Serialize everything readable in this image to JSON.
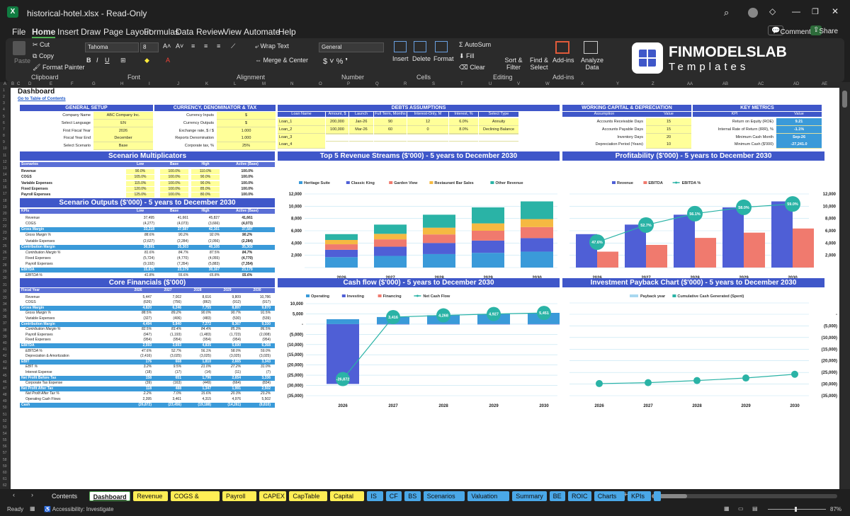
{
  "window": {
    "title": "historical-hotel.xlsx  -  Read-Only"
  },
  "menu": [
    "File",
    "Home",
    "Insert",
    "Draw",
    "Page Layout",
    "Formulas",
    "Data",
    "Review",
    "View",
    "Automate",
    "Help"
  ],
  "topright": {
    "comments": "Comments",
    "share": "Share"
  },
  "ribbon": {
    "paste": "Paste",
    "cut": "Cut",
    "copy": "Copy",
    "format_painter": "Format Painter",
    "clipboard": "Clipboard",
    "font_name": "Tahoma",
    "font_size": "8",
    "font": "Font",
    "wrap": "Wrap Text",
    "merge": "Merge & Center",
    "alignment": "Alignment",
    "numfmt": "General",
    "number": "Number",
    "insert": "Insert",
    "delete": "Delete",
    "format": "Format",
    "cells": "Cells",
    "autosum": "AutoSum",
    "fill": "Fill",
    "clear": "Clear",
    "sort": "Sort & Filter",
    "find": "Find & Select",
    "editing": "Editing",
    "addins": "Add-ins",
    "addins_grp": "Add-ins",
    "analyze": "Analyze Data",
    "brand1": "FINMODELSLAB",
    "brand2": "Templates"
  },
  "columns": [
    "A",
    "B",
    "C",
    "D",
    "E",
    "F",
    "G",
    "H",
    "I",
    "J",
    "K",
    "L",
    "M",
    "N",
    "O",
    "P",
    "Q",
    "R",
    "S",
    "T",
    "U",
    "V",
    "W",
    "X",
    "Y",
    "Z",
    "AA",
    "AB",
    "AC",
    "AD",
    "AE"
  ],
  "sheet": {
    "title": "Dashboard",
    "toc": "Go to Table of Contents",
    "general": {
      "header": "GENERAL SETUP",
      "rows": [
        [
          "Company Name",
          "ABC Company Inc."
        ],
        [
          "Select Language",
          "EN"
        ],
        [
          "First Fiscal Year",
          "2026"
        ],
        [
          "Fiscal Year End",
          "December"
        ],
        [
          "Select Scenario",
          "Base"
        ]
      ]
    },
    "currency": {
      "header": "CURRENCY, DENOMINATOR & TAX",
      "rows": [
        [
          "Currency Inputs",
          "$"
        ],
        [
          "Currency Outputs",
          "$"
        ],
        [
          "Exchange rate, $ / $",
          "1.000"
        ],
        [
          "Reports Denomination",
          "1.000"
        ],
        [
          "Corporate tax, %",
          "25%"
        ]
      ]
    },
    "debts": {
      "header": "DEBTS ASSUMPTIONS",
      "cols": [
        "Loan Name",
        "Amount, $",
        "Launch",
        "Full Term, Months",
        "Interest-Only, M",
        "Interest, %",
        "Select Type"
      ],
      "rows": [
        [
          "Loan_1",
          "200,000",
          "Jan-26",
          "90",
          "12",
          "6.0%",
          "Annuity"
        ],
        [
          "Loan_2",
          "100,000",
          "Mar-26",
          "60",
          "0",
          "8.0%",
          "Declining Balance"
        ],
        [
          "Loan_3",
          "",
          "",
          "",
          "",
          "",
          ""
        ],
        [
          "Loan_4",
          "",
          "",
          "",
          "",
          "",
          ""
        ]
      ]
    },
    "wc": {
      "header": "WORKING CAPITAL & DEPRECIATION",
      "cols": [
        "Assumption",
        "Value"
      ],
      "rows": [
        [
          "Accounts Receivable Days",
          "15"
        ],
        [
          "Accounts Payable Days",
          "15"
        ],
        [
          "Inventory Days",
          "20"
        ],
        [
          "Depreciation Period (Years)",
          "10"
        ]
      ]
    },
    "km": {
      "header": "KEY METRICS",
      "cols": [
        "KPI",
        "Value"
      ],
      "rows": [
        [
          "Return on Equity (ROE)",
          "9.21"
        ],
        [
          "Internal Rate of Return (IRR), %",
          "-1.1%"
        ],
        [
          "Minimum Cash Month",
          "Sep-26"
        ],
        [
          "Minimum Cash ($'000)",
          "-27,241.0"
        ]
      ]
    },
    "scen": {
      "header": "Scenario Multiplicators",
      "cols": [
        "Scenarios",
        "Low",
        "Base",
        "High",
        "Active (Base)"
      ],
      "rows": [
        [
          "Revenue",
          "90.0%",
          "100.0%",
          "110.0%",
          "100.0%"
        ],
        [
          "COGS",
          "105.0%",
          "100.0%",
          "90.0%",
          "100.0%"
        ],
        [
          "Variable Expenses",
          "115.0%",
          "100.0%",
          "90.0%",
          "100.0%"
        ],
        [
          "Fixed Expenses",
          "120.0%",
          "100.0%",
          "85.0%",
          "100.0%"
        ],
        [
          "Payroll Expenses",
          "125.0%",
          "100.0%",
          "80.0%",
          "100.0%"
        ]
      ]
    },
    "so": {
      "header": "Scenario Outputs ($'000) - 5 years to December 2030",
      "cols": [
        "KPIs",
        "Low",
        "Base",
        "High",
        "Active (Base)"
      ],
      "rows": [
        [
          "Revenue",
          "37,495",
          "41,661",
          "45,827",
          "41,661",
          ""
        ],
        [
          "COGS",
          "(4,277)",
          "(4,073)",
          "(3,666)",
          "(4,073)",
          ""
        ],
        [
          "Gross Margin",
          "33,218",
          "37,587",
          "42,161",
          "37,587",
          "hl"
        ],
        [
          "Gross Margin %",
          "88.6%",
          "90.2%",
          "92.0%",
          "90.2%",
          "it"
        ],
        [
          "Variable Expenses",
          "(2,627)",
          "(2,284)",
          "(2,056)",
          "(2,284)",
          ""
        ],
        [
          "Contribution Margin",
          "30,591",
          "35,303",
          "40,105",
          "35,303",
          "hl"
        ],
        [
          "Contribution Margin %",
          "81.6%",
          "84.7%",
          "87.5%",
          "84.7%",
          "it"
        ],
        [
          "Fixed Expenses",
          "(5,724)",
          "(4,770)",
          "(4,055)",
          "(4,770)",
          ""
        ],
        [
          "Payroll Expenses",
          "(9,192)",
          "(7,354)",
          "(5,883)",
          "(7,354)",
          ""
        ],
        [
          "EBITDA",
          "15,675",
          "23,179",
          "30,167",
          "23,179",
          "hl"
        ],
        [
          "EBITDA %",
          "41.8%",
          "55.6%",
          "65.8%",
          "55.6%",
          "it"
        ]
      ]
    },
    "cf": {
      "header": "Core Financials ($'000)",
      "cols": [
        "Fiscal Year",
        "2026",
        "2027",
        "2028",
        "2029",
        "2030"
      ],
      "rows": [
        [
          "Revenue",
          "5,447",
          "7,002",
          "8,616",
          "9,809",
          "10,786",
          ""
        ],
        [
          "COGS",
          "(626)",
          "(756)",
          "(862)",
          "(912)",
          "(917)",
          ""
        ],
        [
          "Gross Margin",
          "4,820",
          "6,246",
          "7,755",
          "8,897",
          "9,870",
          "hl"
        ],
        [
          "Gross Margin %",
          "88.5%",
          "89.2%",
          "90.0%",
          "90.7%",
          "91.5%",
          "it"
        ],
        [
          "Variable Expenses",
          "(327)",
          "(406)",
          "(483)",
          "(530)",
          "(539)",
          ""
        ],
        [
          "Contribution Margin",
          "4,494",
          "5,840",
          "7,272",
          "8,367",
          "9,330",
          "hl"
        ],
        [
          "Contribution Margin %",
          "82.5%",
          "83.4%",
          "84.4%",
          "85.3%",
          "86.5%",
          "it"
        ],
        [
          "Payroll Expenses",
          "(947)",
          "(1,193)",
          "(1,483)",
          "(1,723)",
          "(2,008)",
          ""
        ],
        [
          "Fixed Expenses",
          "(954)",
          "(954)",
          "(954)",
          "(954)",
          "(954)",
          ""
        ],
        [
          "EBITDA",
          "2,593",
          "3,693",
          "4,835",
          "5,690",
          "6,368",
          "hl"
        ],
        [
          "EBITDA %",
          "47.6%",
          "52.7%",
          "56.1%",
          "58.0%",
          "59.0%",
          "it"
        ],
        [
          "Depreciation & Amortization",
          "(2,416)",
          "(3,025)",
          "(3,025)",
          "(3,025)",
          "(3,025)",
          ""
        ],
        [
          "EBIT",
          "176",
          "668",
          "1,810",
          "2,665",
          "3,343",
          "hl"
        ],
        [
          "EBIT %",
          "3.2%",
          "9.5%",
          "21.0%",
          "27.2%",
          "31.0%",
          "it"
        ],
        [
          "Interest Expense",
          "(18)",
          "(17)",
          "(14)",
          "(11)",
          "(7)",
          ""
        ],
        [
          "Net Profit Before Tax",
          "158",
          "651",
          "1,796",
          "2,654",
          "3,336",
          "hl"
        ],
        [
          "Corporate Tax Expense",
          "(39)",
          "(163)",
          "(449)",
          "(664)",
          "(834)",
          ""
        ],
        [
          "Net Profit After Tax",
          "118",
          "488",
          "1,347",
          "1,991",
          "2,502",
          "hl"
        ],
        [
          "Net Profit After Tax %",
          "2.2%",
          "7.0%",
          "15.6%",
          "20.3%",
          "23.2%",
          "it"
        ],
        [
          "Operating Cash Flows",
          "2,395",
          "3,461",
          "4,315",
          "4,976",
          "5,502",
          ""
        ],
        [
          "Cash",
          "(26,872)",
          "(23,456)",
          "(19,188)",
          "(14,261)",
          "(8,810)",
          "hl"
        ]
      ]
    }
  },
  "chart_data": [
    {
      "type": "bar",
      "title": "Top 5 Revenue Streams ($'000) - 5 years to December 2030",
      "stacked": true,
      "categories": [
        "2026",
        "2027",
        "2028",
        "2029",
        "2030"
      ],
      "ylim": [
        0,
        12000
      ],
      "yticks": [
        "12,000",
        "10,000",
        "8,000",
        "6,000",
        "4,000",
        "2,000"
      ],
      "series": [
        {
          "name": "Heritage Suite",
          "color": "#3a9ad9",
          "values": [
            1700,
            1900,
            2200,
            2400,
            2600
          ]
        },
        {
          "name": "Classic King",
          "color": "#4f5fd6",
          "values": [
            1200,
            1500,
            1800,
            2000,
            2200
          ]
        },
        {
          "name": "Garden View",
          "color": "#f07a6e",
          "values": [
            900,
            1200,
            1400,
            1600,
            1800
          ]
        },
        {
          "name": "Restaurant Bar Sales",
          "color": "#f5b942",
          "values": [
            700,
            900,
            1100,
            1200,
            1300
          ]
        },
        {
          "name": "Other Revenue",
          "color": "#2ab3a6",
          "values": [
            947,
            1502,
            2116,
            2609,
            2886
          ]
        }
      ]
    },
    {
      "type": "bar",
      "title": "Profitability ($'000) - 5 years to December 2030",
      "categories": [
        "2026",
        "2027",
        "2028",
        "2029",
        "2030"
      ],
      "ylim": [
        0,
        12000
      ],
      "yticks": [
        "12,000",
        "10,000",
        "8,000",
        "6,000",
        "4,000",
        "2,000"
      ],
      "series": [
        {
          "name": "Revenue",
          "color": "#4f5fd6",
          "values": [
            5447,
            7002,
            8616,
            9809,
            10786
          ]
        },
        {
          "name": "EBITDA",
          "color": "#f07a6e",
          "values": [
            2593,
            3693,
            4835,
            5690,
            6368
          ]
        },
        {
          "name": "EBITDA %",
          "color": "#2ab3a6",
          "type": "line",
          "values": [
            47.6,
            52.7,
            56.1,
            58.0,
            59.0
          ],
          "labels": [
            "47.6%",
            "52.7%",
            "56.1%",
            "58.0%",
            "59.0%"
          ]
        }
      ]
    },
    {
      "type": "bar",
      "title": "Cash flow ($'000) - 5 years to December 2030",
      "categories": [
        "2026",
        "2027",
        "2028",
        "2029",
        "2030"
      ],
      "ylim": [
        -35000,
        10000
      ],
      "yticks": [
        "10,000",
        "5,000",
        "-",
        "(5,000)",
        "(10,000)",
        "(15,000)",
        "(20,000)",
        "(25,000)",
        "(30,000)",
        "(35,000)"
      ],
      "series": [
        {
          "name": "Operating",
          "color": "#3a9ad9",
          "values": [
            2395,
            3461,
            4315,
            4976,
            5502
          ]
        },
        {
          "name": "Investing",
          "color": "#4f5fd6",
          "values": [
            -29267,
            -45,
            -47,
            -49,
            -51
          ]
        },
        {
          "name": "Financing",
          "color": "#f07a6e",
          "values": [
            0,
            0,
            0,
            0,
            0
          ]
        },
        {
          "name": "Net Cash Flow",
          "color": "#2ab3a6",
          "type": "line",
          "values": [
            -26872,
            3416,
            4268,
            4927,
            5451
          ],
          "labels": [
            "-26,872",
            "3,416",
            "4,268",
            "4,927",
            "5,451"
          ]
        }
      ]
    },
    {
      "type": "line",
      "title": "Investment Payback Chart ($'000) - 5 years to December 2030",
      "categories": [
        "2026",
        "2027",
        "2028",
        "2029",
        "2030"
      ],
      "ylim": [
        -35000,
        0
      ],
      "yticks": [
        "-",
        "(5,000)",
        "(10,000)",
        "(15,000)",
        "(20,000)",
        "(25,000)",
        "(30,000)",
        "(35,000)"
      ],
      "series": [
        {
          "name": "Payback year",
          "color": "#a8d8f0",
          "values": []
        },
        {
          "name": "Cumulative Cash Generated (Spent)",
          "color": "#2ab3a6",
          "values": [
            -29800,
            -29400,
            -28500,
            -27400,
            -25800
          ]
        }
      ]
    }
  ],
  "tabs": [
    {
      "label": "Contents",
      "bg": "#1f1f1f",
      "fg": "#e8e8e8"
    },
    {
      "label": "Dashboard",
      "bg": "#ffffff",
      "fg": "#111",
      "active": true
    },
    {
      "label": "Revenue",
      "bg": "#ffee55"
    },
    {
      "label": "COGS & OPEX",
      "bg": "#ffee55"
    },
    {
      "label": "Payroll",
      "bg": "#ffee55"
    },
    {
      "label": "CAPEX",
      "bg": "#ffee55"
    },
    {
      "label": "CapTable",
      "bg": "#ffee55"
    },
    {
      "label": "Capital",
      "bg": "#ffee55"
    },
    {
      "label": "IS",
      "bg": "#4aa8e8"
    },
    {
      "label": "CF",
      "bg": "#4aa8e8"
    },
    {
      "label": "BS",
      "bg": "#4aa8e8"
    },
    {
      "label": "Scenarios",
      "bg": "#4aa8e8"
    },
    {
      "label": "Valuation",
      "bg": "#4aa8e8"
    },
    {
      "label": "Summary",
      "bg": "#4aa8e8"
    },
    {
      "label": "BE",
      "bg": "#4aa8e8"
    },
    {
      "label": "ROIC",
      "bg": "#4aa8e8"
    },
    {
      "label": "Charts",
      "bg": "#4aa8e8"
    },
    {
      "label": "KPIs",
      "bg": "#4aa8e8"
    }
  ],
  "status": {
    "ready": "Ready",
    "access": "Accessibility: Investigate",
    "zoom": "87%"
  }
}
